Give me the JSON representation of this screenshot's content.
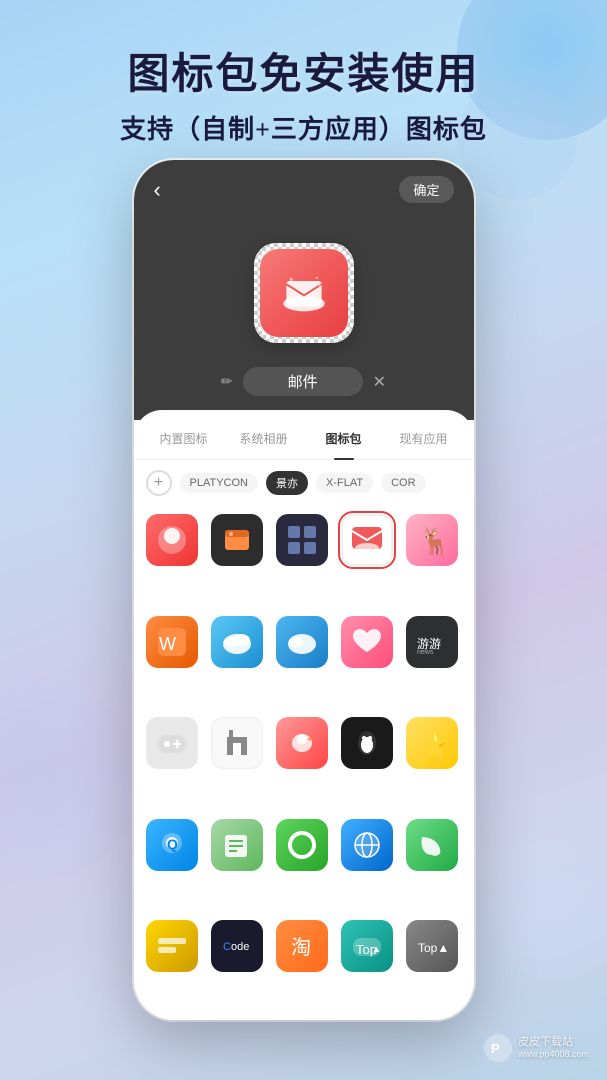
{
  "background": {
    "gradient": "linear-gradient(160deg, #a8d4f5, #cfd5ee)"
  },
  "header": {
    "title": "图标包免安装使用",
    "subtitle": "支持（自制+三方应用）图标包"
  },
  "phone": {
    "back_button": "‹",
    "confirm_button": "确定",
    "app_name": "邮件",
    "edit_icon": "✏",
    "tabs": [
      {
        "label": "内置图标",
        "active": false
      },
      {
        "label": "系统相册",
        "active": false
      },
      {
        "label": "图标包",
        "active": true
      },
      {
        "label": "现有应用",
        "active": false
      }
    ],
    "filter_tags": [
      {
        "label": "PLATYCON",
        "active": false
      },
      {
        "label": "景亦",
        "active": true
      },
      {
        "label": "X-FLAT",
        "active": false
      },
      {
        "label": "COR",
        "active": false
      }
    ],
    "icon_grid": [
      {
        "id": 1,
        "label": "红球",
        "color": "ic-red"
      },
      {
        "id": 2,
        "label": "文件夹",
        "color": "ic-orange-dark"
      },
      {
        "id": 3,
        "label": "矩阵",
        "color": "ic-gray-dark"
      },
      {
        "id": 4,
        "label": "邮件已选",
        "color": "ic-red-border",
        "selected": true
      },
      {
        "id": 5,
        "label": "麋鹿",
        "color": "ic-pink-light"
      },
      {
        "id": 6,
        "label": "Office",
        "color": "ic-orange"
      },
      {
        "id": 7,
        "label": "云蓝1",
        "color": "ic-blue-light"
      },
      {
        "id": 8,
        "label": "云蓝2",
        "color": "ic-blue-cloud"
      },
      {
        "id": 9,
        "label": "爱心",
        "color": "ic-pink-heart"
      },
      {
        "id": 10,
        "label": "游游",
        "color": "ic-dark-gray-text"
      },
      {
        "id": 11,
        "label": "游游2",
        "color": "ic-gray-game"
      },
      {
        "id": 12,
        "label": "建筑",
        "color": "ic-white-bldg"
      },
      {
        "id": 13,
        "label": "红鸟",
        "color": "ic-red-bird"
      },
      {
        "id": 14,
        "label": "企鹅",
        "color": "ic-black-penguin"
      },
      {
        "id": 15,
        "label": "星星",
        "color": "ic-yellow-star"
      },
      {
        "id": 16,
        "label": "蓝Q",
        "color": "ic-blue-q"
      },
      {
        "id": 17,
        "label": "笔记",
        "color": "ic-teal-note"
      },
      {
        "id": 18,
        "label": "循环",
        "color": "ic-green-cycle"
      },
      {
        "id": 19,
        "label": "地球",
        "color": "ic-blue-globe"
      },
      {
        "id": 20,
        "label": "叶子",
        "color": "ic-green-leaf"
      },
      {
        "id": 21,
        "label": "键盘",
        "color": "ic-yellow-btn"
      },
      {
        "id": 22,
        "label": "代码",
        "color": "ic-black-code"
      },
      {
        "id": 23,
        "label": "淘宝",
        "color": "ic-orange-shop"
      },
      {
        "id": 24,
        "label": "游戏",
        "color": "ic-teal-game"
      },
      {
        "id": 25,
        "label": "TopA",
        "color": "ic-gray-top"
      }
    ]
  },
  "watermark": {
    "logo": "P",
    "site": "皮皮下载站",
    "url": "www.pp4008.com"
  }
}
